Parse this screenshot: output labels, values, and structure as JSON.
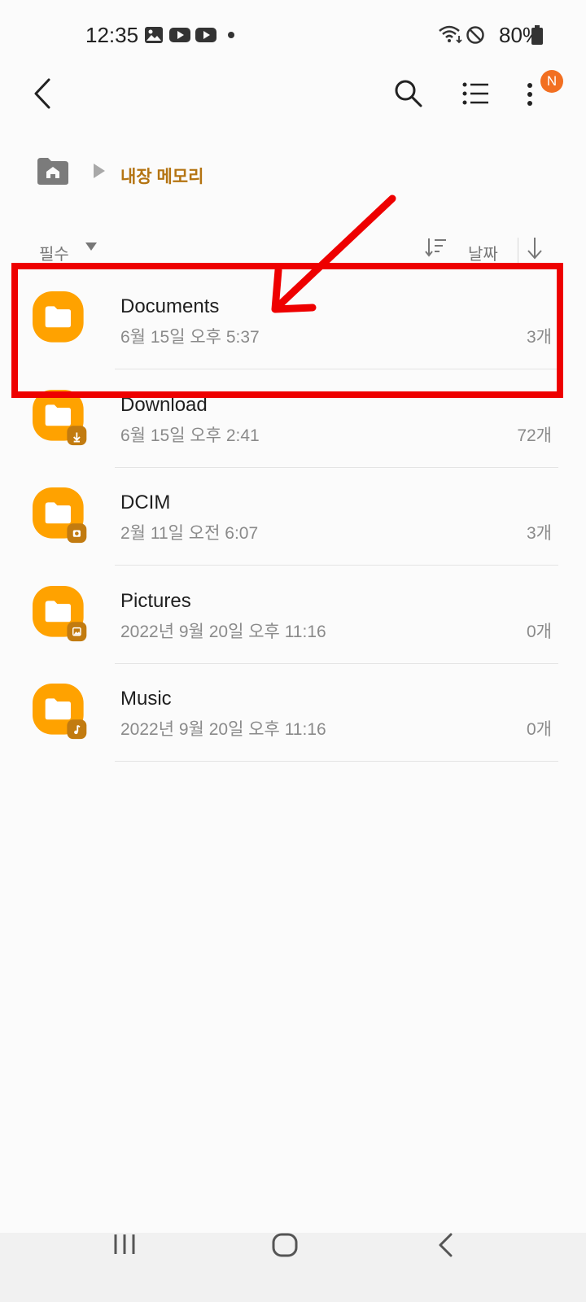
{
  "status_bar": {
    "time": "12:35",
    "battery": "80%",
    "icons": [
      "gallery-icon",
      "youtube-icon",
      "youtube-icon",
      "dot-icon",
      "wifi-icon",
      "do-not-disturb-icon",
      "battery-icon"
    ]
  },
  "toolbar": {
    "icons": [
      "back-icon",
      "search-icon",
      "list-view-icon",
      "more-options-icon"
    ],
    "badge": "N",
    "badge_color": "#f26f21"
  },
  "breadcrumb": {
    "location": "내장 메모리",
    "accent_color": "#b47412"
  },
  "sort_bar": {
    "filter_label": "필수",
    "sort_label": "날짜"
  },
  "folders": [
    {
      "name": "Documents",
      "date": "6월 15일 오후 5:37",
      "count": "3개",
      "badge_icon": "none"
    },
    {
      "name": "Download",
      "date": "6월 15일 오후 2:41",
      "count": "72개",
      "badge_icon": "download-icon"
    },
    {
      "name": "DCIM",
      "date": "2월 11일 오전 6:07",
      "count": "3개",
      "badge_icon": "camera-icon"
    },
    {
      "name": "Pictures",
      "date": "2022년 9월 20일 오후 11:16",
      "count": "0개",
      "badge_icon": "image-icon"
    },
    {
      "name": "Music",
      "date": "2022년 9월 20일 오후 11:16",
      "count": "0개",
      "badge_icon": "music-note-icon"
    }
  ],
  "folder_color": "#ffa200",
  "annotation_color": "#ee0000",
  "nav_bar": {
    "icons": [
      "recent-apps-icon",
      "home-icon",
      "back-nav-icon"
    ]
  }
}
